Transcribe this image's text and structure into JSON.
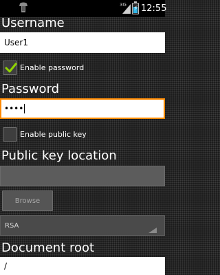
{
  "status_bar": {
    "network_type": "3G",
    "time": "12:55",
    "left_icon": "notification-icon",
    "battery_level": 0.6
  },
  "form": {
    "username": {
      "label": "Username",
      "value": "User1"
    },
    "enable_password": {
      "label": "Enable password",
      "checked": true
    },
    "password": {
      "label": "Password",
      "masked_value": "••••"
    },
    "enable_public_key": {
      "label": "Enable public key",
      "checked": false
    },
    "public_key_location": {
      "label": "Public key location",
      "value": ""
    },
    "browse_button": {
      "label": "Browse"
    },
    "key_type": {
      "selected": "RSA"
    },
    "document_root": {
      "label": "Document root",
      "value": "/"
    }
  },
  "colors": {
    "focus_border": "#ff8a00",
    "check_green": "#8fd400",
    "battery_fill": "#31b6e7"
  }
}
